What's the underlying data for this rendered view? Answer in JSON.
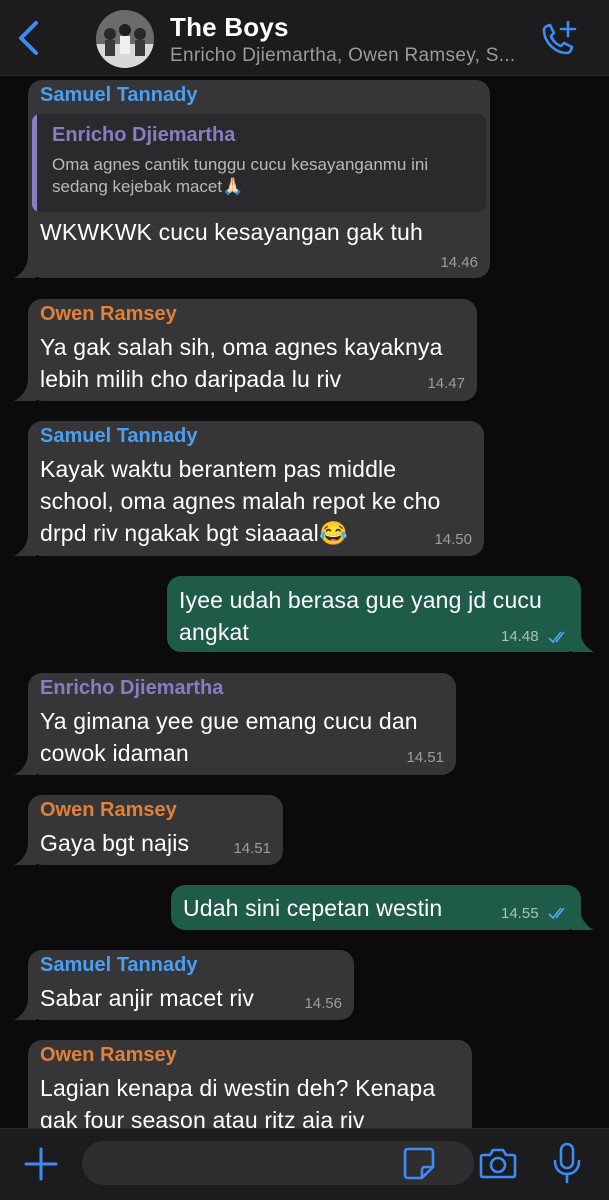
{
  "header": {
    "title": "The Boys",
    "subtitle": "Enricho Djiemartha, Owen Ramsey, S..."
  },
  "colors": {
    "background": "#0b0b0b",
    "header": "#1c1c1e",
    "incoming_bubble": "#363638",
    "outgoing_bubble": "#1f5b49",
    "accent_blue": "#3d8bf5",
    "name_samuel": "#4b9ef0",
    "name_owen": "#e0803a",
    "name_enricho": "#8a7cc2"
  },
  "messages": [
    {
      "sender": "Samuel Tannady",
      "quote": {
        "name": "Enricho Djiemartha",
        "line1": "Oma agnes cantik tunggu cucu kesayanganmu ini",
        "line2": "sedang kejebak macet🙏🏻"
      },
      "line1": "WKWKWK cucu kesayangan gak tuh",
      "time": "14.46"
    },
    {
      "sender": "Owen Ramsey",
      "line1": "Ya gak salah sih, oma agnes kayaknya",
      "line2": "lebih milih cho daripada lu riv",
      "time": "14.47"
    },
    {
      "sender": "Samuel Tannady",
      "line1": "Kayak waktu berantem pas middle",
      "line2": "school, oma agnes malah repot ke cho",
      "line3": "drpd riv ngakak bgt siaaaal😂",
      "time": "14.50"
    },
    {
      "line1": "Iyee udah berasa gue yang jd cucu",
      "line2": "angkat",
      "time": "14.48"
    },
    {
      "sender": "Enricho Djiemartha",
      "line1": "Ya gimana yee gue emang cucu dan",
      "line2": "cowok idaman",
      "time": "14.51"
    },
    {
      "sender": "Owen Ramsey",
      "line1": "Gaya bgt najis",
      "time": "14.51"
    },
    {
      "line1": "Udah sini cepetan westin",
      "time": "14.55"
    },
    {
      "sender": "Samuel Tannady",
      "line1": "Sabar anjir macet riv",
      "time": "14.56"
    },
    {
      "sender": "Owen Ramsey",
      "line1": "Lagian kenapa di westin deh? Kenapa",
      "line2": "gak four season atau ritz aja riv"
    }
  ],
  "input": {
    "placeholder": ""
  }
}
